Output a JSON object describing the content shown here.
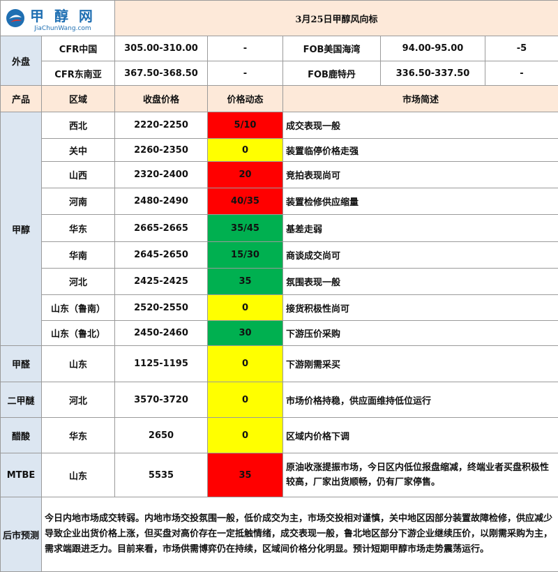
{
  "logo": {
    "cn": "甲 醇 网",
    "en": "JiaChunWang.com"
  },
  "title": "3月25日甲醇风向标",
  "external": {
    "label": "外盘",
    "rows": [
      {
        "name1": "CFR中国",
        "price1": "305.00-310.00",
        "chg1": "-",
        "name2": "FOB美国海湾",
        "price2": "94.00-95.00",
        "chg2": "-5"
      },
      {
        "name1": "CFR东南亚",
        "price1": "367.50-368.50",
        "chg1": "-",
        "name2": "FOB鹿特丹",
        "price2": "336.50-337.50",
        "chg2": "-"
      }
    ]
  },
  "headers": {
    "product": "产品",
    "region": "区域",
    "price": "收盘价格",
    "change": "价格动态",
    "summary": "市场简述"
  },
  "methanol": {
    "product": "甲醇",
    "rows": [
      {
        "region": "西北",
        "price": "2220-2250",
        "change": "5/10",
        "summary": "成交表现一般"
      },
      {
        "region": "关中",
        "price": "2260-2350",
        "change": "0",
        "summary": "装置临停价格走强"
      },
      {
        "region": "山西",
        "price": "2320-2400",
        "change": "20",
        "summary": "竞拍表现尚可"
      },
      {
        "region": "河南",
        "price": "2480-2490",
        "change": "40/35",
        "summary": "装置检修供应缩量"
      },
      {
        "region": "华东",
        "price": "2665-2665",
        "change": "35/45",
        "summary": "基差走弱"
      },
      {
        "region": "华南",
        "price": "2645-2650",
        "change": "15/30",
        "summary": "商谈成交尚可"
      },
      {
        "region": "河北",
        "price": "2425-2425",
        "change": "35",
        "summary": "氛围表现一般"
      },
      {
        "region": "山东（鲁南）",
        "price": "2520-2550",
        "change": "0",
        "summary": "接货积极性尚可"
      },
      {
        "region": "山东（鲁北）",
        "price": "2450-2460",
        "change": "30",
        "summary": "下游压价采购"
      }
    ]
  },
  "others": [
    {
      "product": "甲醛",
      "region": "山东",
      "price": "1125-1195",
      "change": "0",
      "summary": "下游刚需采买"
    },
    {
      "product": "二甲醚",
      "region": "河北",
      "price": "3570-3720",
      "change": "0",
      "summary": "市场价格持稳，供应面维持低位运行"
    },
    {
      "product": "醋酸",
      "region": "华东",
      "price": "2650",
      "change": "0",
      "summary": "区域内价格下调"
    },
    {
      "product": "MTBE",
      "region": "山东",
      "price": "5535",
      "change": "35",
      "summary": "原油收涨提振市场，今日区内低位报盘缩减，终端业者买盘积极性较高，厂家出货顺畅，仍有厂家停售。"
    }
  ],
  "forecast": {
    "label": "后市预测",
    "text": "今日内地市场成交转弱。内地市场交投氛围一般，低价成交为主，市场交投相对谨慎，关中地区因部分装置故障检修，供应减少导致企业出货价格上涨，但买盘对高价存在一定抵触情绪，成交表现一般，鲁北地区部分下游企业继续压价，以刚需采购为主，需求端跟进乏力。目前来看，市场供需博弈仍在持续，区域间价格分化明显。预计短期甲醇市场走势震荡运行。"
  },
  "colors": {
    "up": "#ff0000",
    "flat": "#ffff00",
    "mixed_up": "#00b050",
    "header_bg": "#fde9d9",
    "label_bg": "#dce6f1",
    "brand": "#1f6fb2"
  }
}
